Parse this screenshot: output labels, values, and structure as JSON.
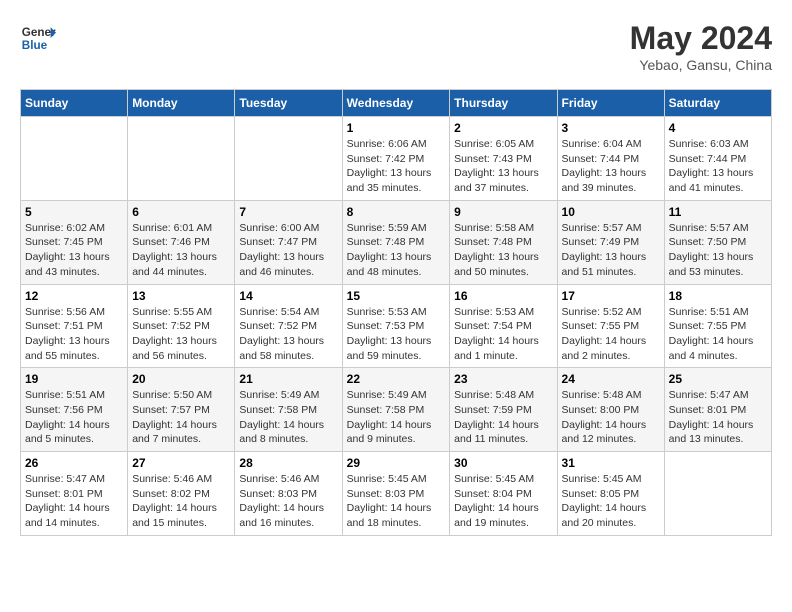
{
  "header": {
    "logo_text_general": "General",
    "logo_text_blue": "Blue",
    "month_year": "May 2024",
    "location": "Yebao, Gansu, China"
  },
  "weekdays": [
    "Sunday",
    "Monday",
    "Tuesday",
    "Wednesday",
    "Thursday",
    "Friday",
    "Saturday"
  ],
  "weeks": [
    [
      {
        "day": "",
        "sunrise": "",
        "sunset": "",
        "daylight": ""
      },
      {
        "day": "",
        "sunrise": "",
        "sunset": "",
        "daylight": ""
      },
      {
        "day": "",
        "sunrise": "",
        "sunset": "",
        "daylight": ""
      },
      {
        "day": "1",
        "sunrise": "Sunrise: 6:06 AM",
        "sunset": "Sunset: 7:42 PM",
        "daylight": "Daylight: 13 hours and 35 minutes."
      },
      {
        "day": "2",
        "sunrise": "Sunrise: 6:05 AM",
        "sunset": "Sunset: 7:43 PM",
        "daylight": "Daylight: 13 hours and 37 minutes."
      },
      {
        "day": "3",
        "sunrise": "Sunrise: 6:04 AM",
        "sunset": "Sunset: 7:44 PM",
        "daylight": "Daylight: 13 hours and 39 minutes."
      },
      {
        "day": "4",
        "sunrise": "Sunrise: 6:03 AM",
        "sunset": "Sunset: 7:44 PM",
        "daylight": "Daylight: 13 hours and 41 minutes."
      }
    ],
    [
      {
        "day": "5",
        "sunrise": "Sunrise: 6:02 AM",
        "sunset": "Sunset: 7:45 PM",
        "daylight": "Daylight: 13 hours and 43 minutes."
      },
      {
        "day": "6",
        "sunrise": "Sunrise: 6:01 AM",
        "sunset": "Sunset: 7:46 PM",
        "daylight": "Daylight: 13 hours and 44 minutes."
      },
      {
        "day": "7",
        "sunrise": "Sunrise: 6:00 AM",
        "sunset": "Sunset: 7:47 PM",
        "daylight": "Daylight: 13 hours and 46 minutes."
      },
      {
        "day": "8",
        "sunrise": "Sunrise: 5:59 AM",
        "sunset": "Sunset: 7:48 PM",
        "daylight": "Daylight: 13 hours and 48 minutes."
      },
      {
        "day": "9",
        "sunrise": "Sunrise: 5:58 AM",
        "sunset": "Sunset: 7:48 PM",
        "daylight": "Daylight: 13 hours and 50 minutes."
      },
      {
        "day": "10",
        "sunrise": "Sunrise: 5:57 AM",
        "sunset": "Sunset: 7:49 PM",
        "daylight": "Daylight: 13 hours and 51 minutes."
      },
      {
        "day": "11",
        "sunrise": "Sunrise: 5:57 AM",
        "sunset": "Sunset: 7:50 PM",
        "daylight": "Daylight: 13 hours and 53 minutes."
      }
    ],
    [
      {
        "day": "12",
        "sunrise": "Sunrise: 5:56 AM",
        "sunset": "Sunset: 7:51 PM",
        "daylight": "Daylight: 13 hours and 55 minutes."
      },
      {
        "day": "13",
        "sunrise": "Sunrise: 5:55 AM",
        "sunset": "Sunset: 7:52 PM",
        "daylight": "Daylight: 13 hours and 56 minutes."
      },
      {
        "day": "14",
        "sunrise": "Sunrise: 5:54 AM",
        "sunset": "Sunset: 7:52 PM",
        "daylight": "Daylight: 13 hours and 58 minutes."
      },
      {
        "day": "15",
        "sunrise": "Sunrise: 5:53 AM",
        "sunset": "Sunset: 7:53 PM",
        "daylight": "Daylight: 13 hours and 59 minutes."
      },
      {
        "day": "16",
        "sunrise": "Sunrise: 5:53 AM",
        "sunset": "Sunset: 7:54 PM",
        "daylight": "Daylight: 14 hours and 1 minute."
      },
      {
        "day": "17",
        "sunrise": "Sunrise: 5:52 AM",
        "sunset": "Sunset: 7:55 PM",
        "daylight": "Daylight: 14 hours and 2 minutes."
      },
      {
        "day": "18",
        "sunrise": "Sunrise: 5:51 AM",
        "sunset": "Sunset: 7:55 PM",
        "daylight": "Daylight: 14 hours and 4 minutes."
      }
    ],
    [
      {
        "day": "19",
        "sunrise": "Sunrise: 5:51 AM",
        "sunset": "Sunset: 7:56 PM",
        "daylight": "Daylight: 14 hours and 5 minutes."
      },
      {
        "day": "20",
        "sunrise": "Sunrise: 5:50 AM",
        "sunset": "Sunset: 7:57 PM",
        "daylight": "Daylight: 14 hours and 7 minutes."
      },
      {
        "day": "21",
        "sunrise": "Sunrise: 5:49 AM",
        "sunset": "Sunset: 7:58 PM",
        "daylight": "Daylight: 14 hours and 8 minutes."
      },
      {
        "day": "22",
        "sunrise": "Sunrise: 5:49 AM",
        "sunset": "Sunset: 7:58 PM",
        "daylight": "Daylight: 14 hours and 9 minutes."
      },
      {
        "day": "23",
        "sunrise": "Sunrise: 5:48 AM",
        "sunset": "Sunset: 7:59 PM",
        "daylight": "Daylight: 14 hours and 11 minutes."
      },
      {
        "day": "24",
        "sunrise": "Sunrise: 5:48 AM",
        "sunset": "Sunset: 8:00 PM",
        "daylight": "Daylight: 14 hours and 12 minutes."
      },
      {
        "day": "25",
        "sunrise": "Sunrise: 5:47 AM",
        "sunset": "Sunset: 8:01 PM",
        "daylight": "Daylight: 14 hours and 13 minutes."
      }
    ],
    [
      {
        "day": "26",
        "sunrise": "Sunrise: 5:47 AM",
        "sunset": "Sunset: 8:01 PM",
        "daylight": "Daylight: 14 hours and 14 minutes."
      },
      {
        "day": "27",
        "sunrise": "Sunrise: 5:46 AM",
        "sunset": "Sunset: 8:02 PM",
        "daylight": "Daylight: 14 hours and 15 minutes."
      },
      {
        "day": "28",
        "sunrise": "Sunrise: 5:46 AM",
        "sunset": "Sunset: 8:03 PM",
        "daylight": "Daylight: 14 hours and 16 minutes."
      },
      {
        "day": "29",
        "sunrise": "Sunrise: 5:45 AM",
        "sunset": "Sunset: 8:03 PM",
        "daylight": "Daylight: 14 hours and 18 minutes."
      },
      {
        "day": "30",
        "sunrise": "Sunrise: 5:45 AM",
        "sunset": "Sunset: 8:04 PM",
        "daylight": "Daylight: 14 hours and 19 minutes."
      },
      {
        "day": "31",
        "sunrise": "Sunrise: 5:45 AM",
        "sunset": "Sunset: 8:05 PM",
        "daylight": "Daylight: 14 hours and 20 minutes."
      },
      {
        "day": "",
        "sunrise": "",
        "sunset": "",
        "daylight": ""
      }
    ]
  ]
}
